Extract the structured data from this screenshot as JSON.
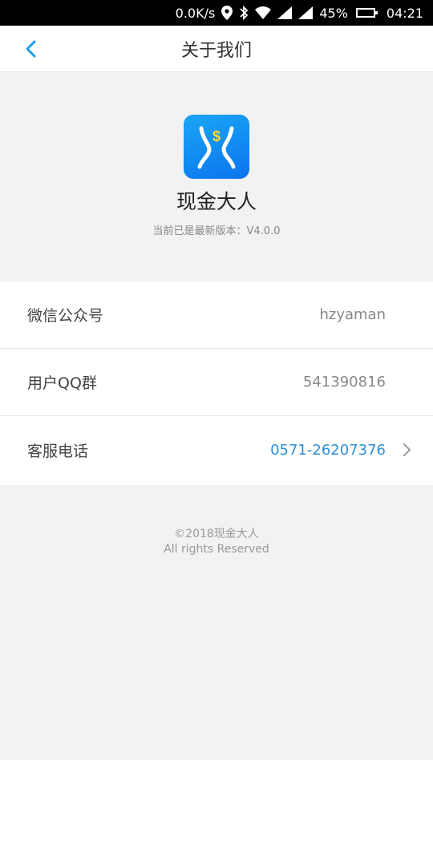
{
  "status_bar": {
    "speed": "0.0K/s",
    "battery_percent": "45%",
    "battery_level": 0.45,
    "time": "04:21",
    "icons": [
      "location-icon",
      "bluetooth-icon",
      "wifi-icon",
      "signal-icon",
      "signal-icon",
      "battery-icon"
    ]
  },
  "nav": {
    "title": "关于我们",
    "back_icon": "chevron-left-icon"
  },
  "app": {
    "name": "现金大人",
    "version_text": "当前已是最新版本：V4.0.0",
    "icon_name": "app-logo-icon",
    "icon_colors": [
      "#1ba6f5",
      "#0a74ee"
    ],
    "icon_symbol": "$"
  },
  "info_rows": [
    {
      "label": "微信公众号",
      "value": "hzyaman"
    },
    {
      "label": "用户QQ群",
      "value": "541390816"
    },
    {
      "label": "客服电话",
      "value": "0571-26207376"
    }
  ],
  "footer": {
    "copyright": "©2018现金大人",
    "rights": "All rights Reserved"
  },
  "colors": {
    "accent": "#2d8fd8",
    "background": "#f2f2f2"
  }
}
